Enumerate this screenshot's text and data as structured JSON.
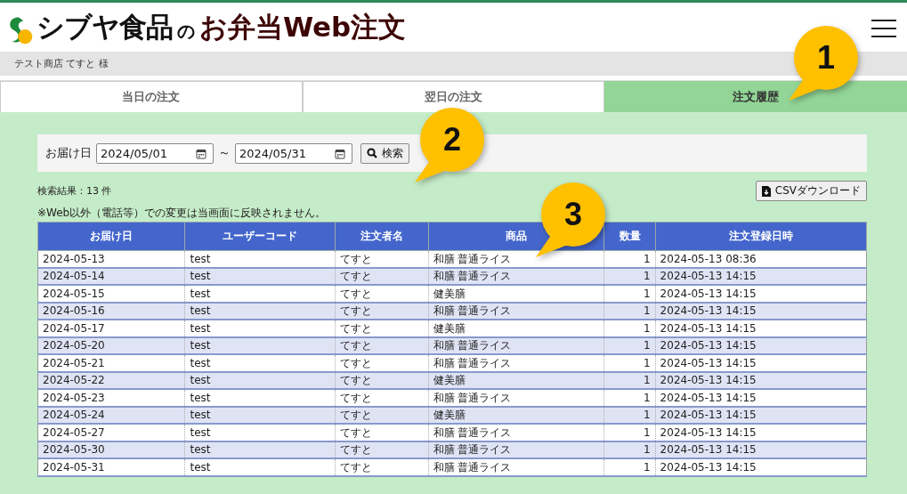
{
  "header": {
    "brand": "シブヤ食品",
    "brand_joiner": "の",
    "service": "お弁当Web注文"
  },
  "user_bar": {
    "text": "テスト商店 てすと 様"
  },
  "tabs": [
    {
      "label": "当日の注文",
      "selected": false
    },
    {
      "label": "翌日の注文",
      "selected": false
    },
    {
      "label": "注文履歴",
      "selected": true
    }
  ],
  "search": {
    "label": "お届け日",
    "from": "2024/05/01",
    "separator": "～",
    "to": "2024/05/31",
    "button": "検索"
  },
  "result_count": "検索結果：13 件",
  "csv_button": "CSVダウンロード",
  "note": "※Web以外（電話等）での変更は当画面に反映されません。",
  "table": {
    "columns": [
      "お届け日",
      "ユーザーコード",
      "注文者名",
      "商品",
      "数量",
      "注文登録日時"
    ],
    "rows": [
      [
        "2024-05-13",
        "test",
        "てすと",
        "和膳 普通ライス",
        "1",
        "2024-05-13 08:36"
      ],
      [
        "2024-05-14",
        "test",
        "てすと",
        "和膳 普通ライス",
        "1",
        "2024-05-13 14:15"
      ],
      [
        "2024-05-15",
        "test",
        "てすと",
        "健美膳",
        "1",
        "2024-05-13 14:15"
      ],
      [
        "2024-05-16",
        "test",
        "てすと",
        "和膳 普通ライス",
        "1",
        "2024-05-13 14:15"
      ],
      [
        "2024-05-17",
        "test",
        "てすと",
        "健美膳",
        "1",
        "2024-05-13 14:15"
      ],
      [
        "2024-05-20",
        "test",
        "てすと",
        "和膳 普通ライス",
        "1",
        "2024-05-13 14:15"
      ],
      [
        "2024-05-21",
        "test",
        "てすと",
        "和膳 普通ライス",
        "1",
        "2024-05-13 14:15"
      ],
      [
        "2024-05-22",
        "test",
        "てすと",
        "健美膳",
        "1",
        "2024-05-13 14:15"
      ],
      [
        "2024-05-23",
        "test",
        "てすと",
        "和膳 普通ライス",
        "1",
        "2024-05-13 14:15"
      ],
      [
        "2024-05-24",
        "test",
        "てすと",
        "健美膳",
        "1",
        "2024-05-13 14:15"
      ],
      [
        "2024-05-27",
        "test",
        "てすと",
        "和膳 普通ライス",
        "1",
        "2024-05-13 14:15"
      ],
      [
        "2024-05-30",
        "test",
        "てすと",
        "和膳 普通ライス",
        "1",
        "2024-05-13 14:15"
      ],
      [
        "2024-05-31",
        "test",
        "てすと",
        "和膳 普通ライス",
        "1",
        "2024-05-13 14:15"
      ]
    ]
  },
  "callouts": [
    {
      "number": "1"
    },
    {
      "number": "2"
    },
    {
      "number": "3"
    }
  ]
}
